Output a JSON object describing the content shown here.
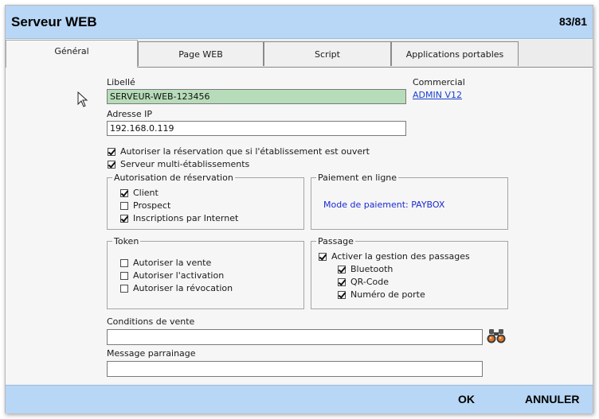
{
  "window": {
    "title": "Serveur WEB",
    "counter": "83/81"
  },
  "tabs": [
    {
      "label": "Général",
      "active": true
    },
    {
      "label": "Page WEB",
      "active": false
    },
    {
      "label": "Script",
      "active": false
    },
    {
      "label": "Applications portables",
      "active": false
    }
  ],
  "form": {
    "libelle_label": "Libellé",
    "libelle_value": "SERVEUR-WEB-123456",
    "commercial_label": "Commercial",
    "commercial_link": "ADMIN V12",
    "ip_label": "Adresse IP",
    "ip_value": "192.168.0.119",
    "options": [
      {
        "label": "Autoriser la réservation que si l'établissement est ouvert",
        "checked": true
      },
      {
        "label": "Serveur multi-établissements",
        "checked": true
      }
    ],
    "conditions_label": "Conditions de vente",
    "conditions_value": "",
    "parrainage_label": "Message parrainage",
    "parrainage_value": ""
  },
  "groups": {
    "reservation": {
      "title": "Autorisation de réservation",
      "items": [
        {
          "label": "Client",
          "checked": true
        },
        {
          "label": "Prospect",
          "checked": false
        },
        {
          "label": "Inscriptions par Internet",
          "checked": true
        }
      ]
    },
    "paiement": {
      "title": "Paiement en ligne",
      "mode": "Mode de paiement: PAYBOX"
    },
    "token": {
      "title": "Token",
      "items": [
        {
          "label": "Autoriser la vente",
          "checked": false
        },
        {
          "label": "Autoriser l'activation",
          "checked": false
        },
        {
          "label": "Autoriser la révocation",
          "checked": false
        }
      ]
    },
    "passage": {
      "title": "Passage",
      "main": {
        "label": "Activer la gestion des passages",
        "checked": true
      },
      "items": [
        {
          "label": "Bluetooth",
          "checked": true
        },
        {
          "label": "QR-Code",
          "checked": true
        },
        {
          "label": "Numéro de porte",
          "checked": true
        }
      ]
    }
  },
  "footer": {
    "ok": "OK",
    "cancel": "ANNULER"
  },
  "colors": {
    "bar": "#b8d6f5",
    "field_highlight": "#b7dcb9",
    "link": "#1a3fcf"
  }
}
